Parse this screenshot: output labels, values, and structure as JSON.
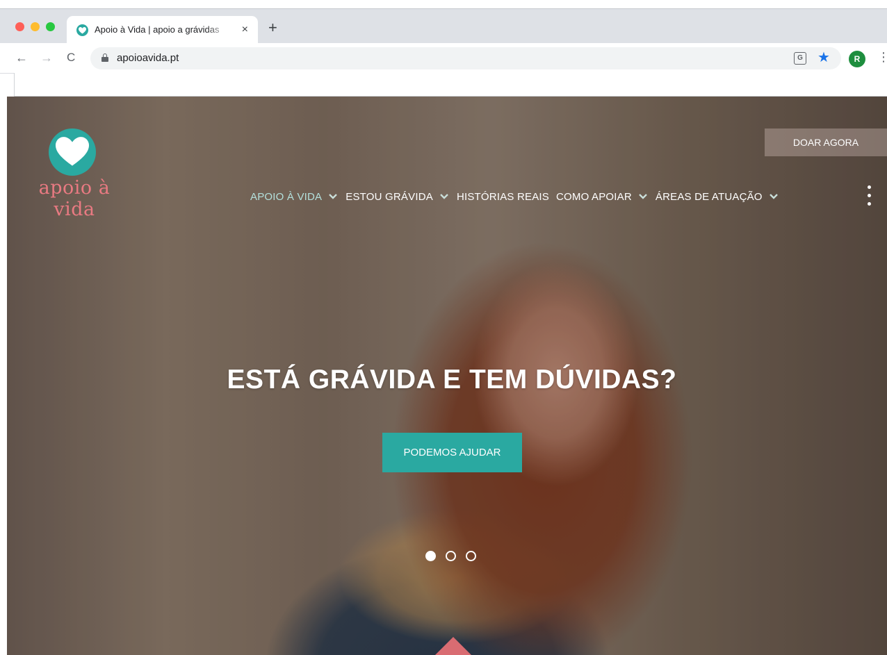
{
  "browser": {
    "tab": {
      "title": "Apoio à Vida | apoio a grávidas",
      "close": "×"
    },
    "new_tab": "+",
    "nav": {
      "back": "←",
      "forward": "→",
      "reload": "C"
    },
    "url": "apoioavida.pt",
    "star": "★",
    "avatar_letter": "R",
    "menu": "⋮",
    "translate_glyph": "G"
  },
  "site": {
    "logo_text": "apoio à vida",
    "donate_label": "DOAR AGORA",
    "nav": [
      {
        "label": "APOIO À VIDA",
        "has_dropdown": true,
        "active": true
      },
      {
        "label": "ESTOU GRÁVIDA",
        "has_dropdown": true,
        "active": false
      },
      {
        "label": "HISTÓRIAS REAIS",
        "has_dropdown": false,
        "active": false
      },
      {
        "label": "COMO APOIAR",
        "has_dropdown": true,
        "active": false
      },
      {
        "label": "ÁREAS DE ATUAÇÃO",
        "has_dropdown": true,
        "active": false
      }
    ],
    "hero": {
      "heading": "ESTÁ GRÁVIDA E TEM DÚVIDAS?",
      "cta_label": "PODEMOS AJUDAR",
      "slides_total": 3,
      "active_slide": 1
    }
  },
  "colors": {
    "brand_teal": "#2aa9a1",
    "brand_pink": "#e97a82",
    "star_blue": "#1a73e8",
    "avatar_green": "#1e8e3e"
  }
}
